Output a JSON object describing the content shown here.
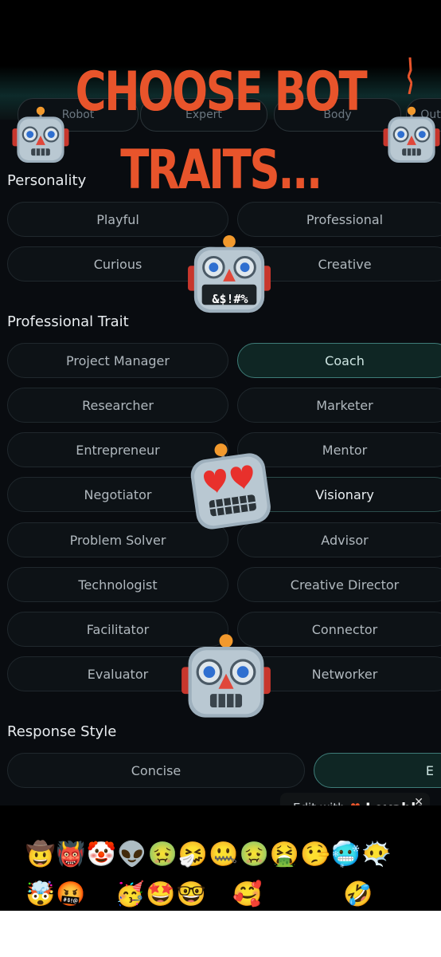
{
  "overlay": {
    "headline_line1": "CHOOSE BOT",
    "headline_line2": "TRAITS..."
  },
  "top_row": [
    "Robot",
    "Expert",
    "Body",
    "Out"
  ],
  "personality": {
    "title": "Personality",
    "options": [
      "Playful",
      "Professional",
      "Curious",
      "Creative"
    ]
  },
  "professional": {
    "title": "Professional Trait",
    "options": [
      "Project Manager",
      "Coach",
      "Researcher",
      "Marketer",
      "Entrepreneur",
      "Mentor",
      "Negotiator",
      "Visionary",
      "Problem Solver",
      "Advisor",
      "Technologist",
      "Creative Director",
      "Facilitator",
      "Connector",
      "Evaluator",
      "Networker"
    ],
    "selected": "Coach"
  },
  "response": {
    "title": "Response Style",
    "options": [
      "Concise",
      "E"
    ]
  },
  "robots": {
    "curse_text": "&$!#%"
  },
  "lovable_badge": {
    "text": "Edit with",
    "brand": "Lovable",
    "close": "✕"
  },
  "emoji_tray": {
    "row1": [
      "🤠",
      "👹",
      "🤡",
      "👽",
      "🤢",
      "🤧",
      "🤐",
      "🤢",
      "🤮",
      "🤥",
      "🥶",
      "😶‍🌫️"
    ],
    "row2": [
      "🤯",
      "🤬",
      "😭",
      "🥳",
      "🤩",
      "🤓",
      "😘",
      "🥰",
      "😎",
      "😇",
      "😂",
      "🤣"
    ]
  },
  "colors": {
    "accent_teal": "#3e7c78",
    "headline_orange": "#e8542b"
  }
}
